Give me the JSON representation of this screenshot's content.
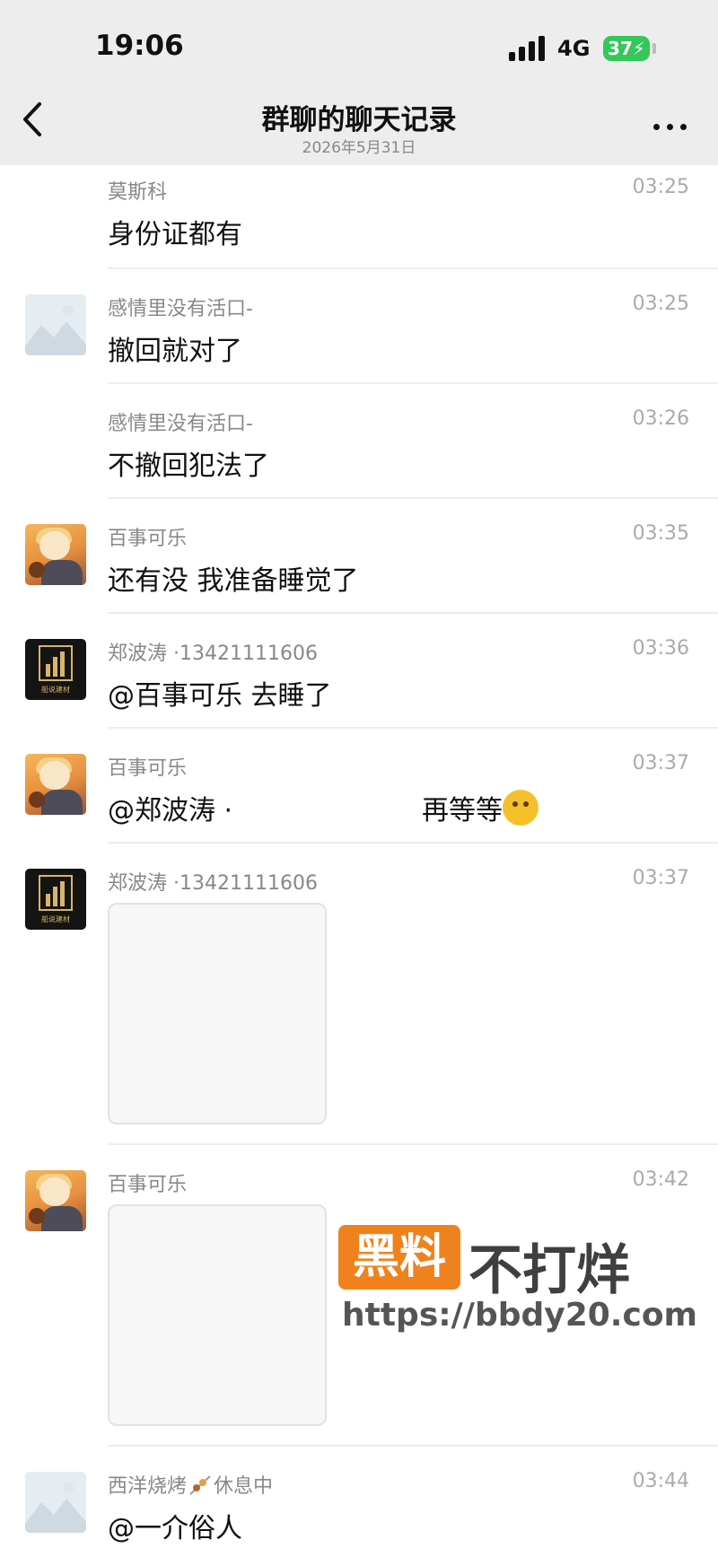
{
  "status_bar": {
    "time": "19:06",
    "network": "4G",
    "battery": "37"
  },
  "nav": {
    "title": "群聊的聊天记录",
    "date": "2026年5月31日"
  },
  "icons": {
    "back": "chevron-left-icon",
    "more": "more-dots-icon",
    "signal": "signal-icon",
    "battery": "battery-charging-icon"
  },
  "messages": [
    {
      "sender": "莫斯科",
      "time": "03:25",
      "text": "身份证都有",
      "avatar": "none"
    },
    {
      "sender": "感情里没有活口-",
      "time": "03:25",
      "text": "撤回就对了",
      "avatar": "placeholder"
    },
    {
      "sender": "感情里没有活口-",
      "time": "03:26",
      "text": "不撤回犯法了",
      "avatar": "none"
    },
    {
      "sender": "百事可乐",
      "time": "03:35",
      "text": "还有没 我准备睡觉了",
      "avatar": "anime"
    },
    {
      "sender": "郑波涛 ·13421111606",
      "time": "03:36",
      "text": "@百事可乐 去睡了",
      "avatar": "logo"
    },
    {
      "sender": "百事可乐",
      "time": "03:37",
      "text_start": "@郑波涛 ·",
      "text_end": "再等等",
      "avatar": "anime",
      "emoji": "emoji-icon"
    },
    {
      "sender": "郑波涛 ·13421111606",
      "time": "03:37",
      "image": true,
      "avatar": "logo"
    },
    {
      "sender": "百事可乐",
      "time": "03:42",
      "image": true,
      "avatar": "anime"
    },
    {
      "sender": "西洋烧烤",
      "sender_suffix": "休息中",
      "time": "03:44",
      "text": "@一介俗人",
      "avatar": "placeholder",
      "sender_icon": "skewer-icon"
    }
  ],
  "watermark": {
    "box": "黑料",
    "text": "不打烊",
    "url": "https://bbdy20.com"
  },
  "avatar_logo_caption": "船说建材",
  "colors": {
    "bar_bg": "#ededed",
    "battery": "#34c759",
    "watermark_orange": "#f0821e"
  }
}
